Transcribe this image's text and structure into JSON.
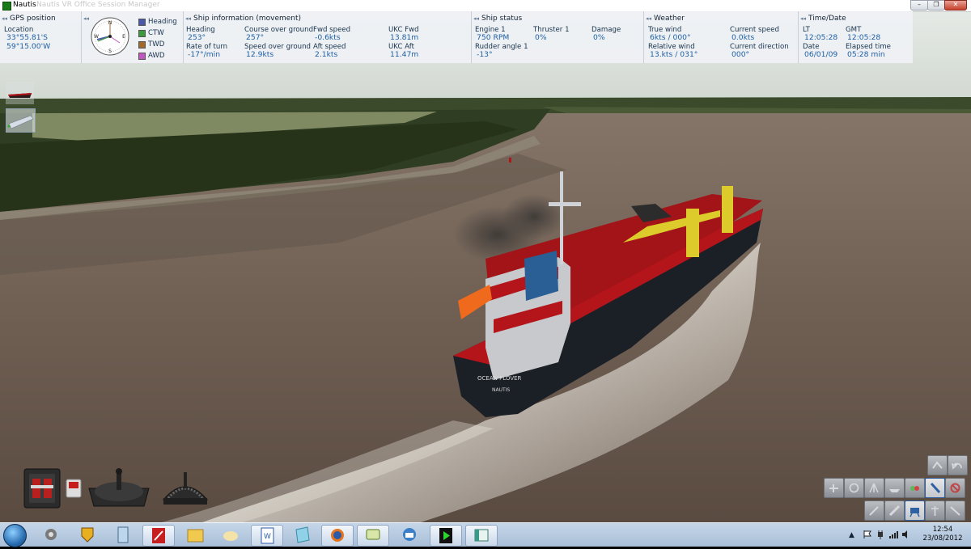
{
  "window": {
    "title": "Nautis",
    "subtitle": "Nautis VR Office Session Manager",
    "controls": [
      "minimize",
      "maximize",
      "close"
    ]
  },
  "gps": {
    "header": "GPS position",
    "location_label": "Location",
    "lat": "33°55.81'S",
    "lon": "59°15.00'W"
  },
  "compass_legend": [
    {
      "label": "Heading",
      "color": "#4a5aa8"
    },
    {
      "label": "CTW",
      "color": "#3d9a3d"
    },
    {
      "label": "TWD",
      "color": "#a06a2a"
    },
    {
      "label": "AWD",
      "color": "#c056c0"
    }
  ],
  "compass": {
    "n": "N",
    "s": "S",
    "e": "E",
    "w": "W"
  },
  "movement": {
    "header": "Ship information (movement)",
    "heading_label": "Heading",
    "heading": "253°",
    "rot_label": "Rate of turn",
    "rot": "-17°/min",
    "cog_label": "Course over ground",
    "cog": "257°",
    "sog_label": "Speed over ground",
    "sog": "12.9kts",
    "fwd_label": "Fwd speed",
    "fwd": "-0.6kts",
    "aft_label": "Aft speed",
    "aft": "2.1kts",
    "ukc_fwd_label": "UKC Fwd",
    "ukc_fwd": "13.81m",
    "ukc_aft_label": "UKC Aft",
    "ukc_aft": "11.47m"
  },
  "status": {
    "header": "Ship status",
    "engine_label": "Engine 1",
    "engine": "750 RPM",
    "rudder_label": "Rudder angle 1",
    "rudder": "-13°",
    "thruster_label": "Thruster 1",
    "thruster": "0%",
    "damage_label": "Damage",
    "damage": "0%"
  },
  "weather": {
    "header": "Weather",
    "true_wind_label": "True wind",
    "true_wind": "6kts / 000°",
    "rel_wind_label": "Relative wind",
    "rel_wind": "13.kts / 031°",
    "cur_speed_label": "Current speed",
    "cur_speed": "0.0kts",
    "cur_dir_label": "Current direction",
    "cur_dir": "000°"
  },
  "time": {
    "header": "Time/Date",
    "lt_label": "LT",
    "lt": "12:05:28",
    "gmt_label": "GMT",
    "gmt": "12:05:28",
    "date_label": "Date",
    "date": "06/01/09",
    "elapsed_label": "Elapsed time",
    "elapsed": "05:28 min"
  },
  "ship": {
    "name": "OCEAN PLOVER",
    "port": "NAUTIS"
  },
  "taskbar": {
    "apps": [
      "start-orb",
      "settings",
      "shield",
      "calculator",
      "acrobat",
      "folder",
      "cloud",
      "word",
      "notepad",
      "firefox",
      "chat",
      "thunderbird",
      "nautis",
      "window"
    ],
    "tray_arrow": "▲",
    "time": "12:54",
    "date": "23/08/2012"
  },
  "colors": {
    "hud_bg": "#eef0f4",
    "hud_value": "#1d5fa5",
    "hull_red": "#b3151b",
    "water": "#6e5f55"
  }
}
